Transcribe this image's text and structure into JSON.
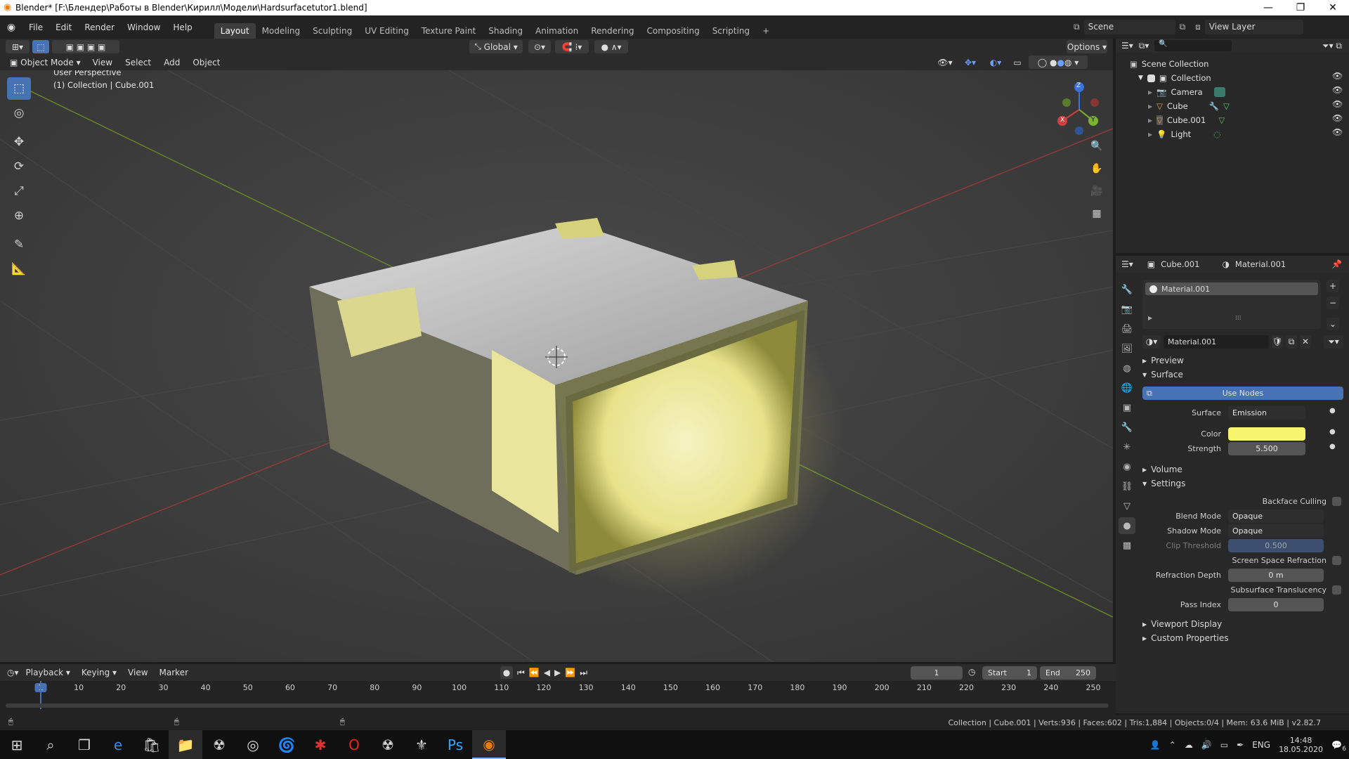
{
  "window": {
    "title": "Blender* [F:\\Блендер\\Работы в Blender\\Кирилл\\Модели\\Hardsurfacetutor1.blend]"
  },
  "menus": [
    "File",
    "Edit",
    "Render",
    "Window",
    "Help"
  ],
  "workspaces": [
    {
      "label": "Layout",
      "active": true
    },
    {
      "label": "Modeling"
    },
    {
      "label": "Sculpting"
    },
    {
      "label": "UV Editing"
    },
    {
      "label": "Texture Paint"
    },
    {
      "label": "Shading"
    },
    {
      "label": "Animation"
    },
    {
      "label": "Rendering"
    },
    {
      "label": "Compositing"
    },
    {
      "label": "Scripting"
    }
  ],
  "scene": {
    "label": "Scene",
    "view_layer": "View Layer"
  },
  "viewport_header": {
    "mode": "Object Mode",
    "view": "View",
    "select": "Select",
    "add": "Add",
    "object": "Object",
    "orientation": "Global",
    "options": "Options"
  },
  "viewport": {
    "perspective": "User Perspective",
    "context": "(1) Collection | Cube.001"
  },
  "gizmo": {
    "z": "Z",
    "y": "Y",
    "x": "X"
  },
  "outliner": {
    "root": "Scene Collection",
    "collection": "Collection",
    "items": [
      {
        "label": "Camera",
        "icon": "camera-icon"
      },
      {
        "label": "Cube",
        "icon": "mesh-icon"
      },
      {
        "label": "Cube.001",
        "icon": "mesh-icon"
      },
      {
        "label": "Light",
        "icon": "light-icon"
      }
    ]
  },
  "properties": {
    "object": "Cube.001",
    "material_tab": "Material.001",
    "slot": "Material.001",
    "material_name": "Material.001",
    "preview": "Preview",
    "surface_section": "Surface",
    "use_nodes": "Use Nodes",
    "surface_label": "Surface",
    "surface_value": "Emission",
    "color_label": "Color",
    "color": "#f7f56e",
    "strength_label": "Strength",
    "strength": "5.500",
    "volume": "Volume",
    "settings": "Settings",
    "backface": "Backface Culling",
    "blend_label": "Blend Mode",
    "blend": "Opaque",
    "shadow_label": "Shadow Mode",
    "shadow": "Opaque",
    "clip_label": "Clip Threshold",
    "clip": "0.500",
    "ssr": "Screen Space Refraction",
    "refr_label": "Refraction Depth",
    "refr": "0 m",
    "sss": "Subsurface Translucency",
    "pass_label": "Pass Index",
    "pass": "0",
    "viewport_display": "Viewport Display",
    "custom_props": "Custom Properties"
  },
  "timeline": {
    "playback": "Playback",
    "keying": "Keying",
    "view": "View",
    "marker": "Marker",
    "current_frame": "1",
    "start_label": "Start",
    "start": "1",
    "end_label": "End",
    "end": "250",
    "ticks": [
      "1",
      "10",
      "20",
      "30",
      "40",
      "50",
      "60",
      "70",
      "80",
      "90",
      "100",
      "110",
      "120",
      "130",
      "140",
      "150",
      "160",
      "170",
      "180",
      "190",
      "200",
      "210",
      "220",
      "230",
      "240",
      "250"
    ]
  },
  "status": {
    "text": "Collection | Cube.001 | Verts:936 | Faces:602 | Tris:1,884 | Objects:0/4 | Mem: 63.6 MiB | v2.82.7"
  },
  "taskbar": {
    "lang": "ENG",
    "time": "14:48",
    "date": "18.05.2020",
    "notif": "6"
  },
  "colors": {
    "accent": "#4772b3",
    "emission": "#f7f56e"
  }
}
